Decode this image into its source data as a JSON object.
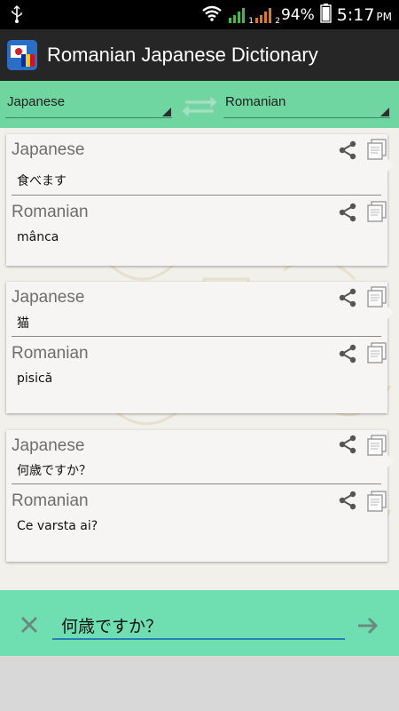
{
  "status_bar": {
    "battery_percent": "94%",
    "time": "5:17",
    "ampm": "PM",
    "signal_sim1": "1",
    "signal_sim2": "2"
  },
  "app": {
    "title": "Romanian Japanese Dictionary"
  },
  "language_selector": {
    "source": "Japanese",
    "target": "Romanian"
  },
  "cards": [
    {
      "source_label": "Japanese",
      "source_text": "食べます",
      "target_label": "Romanian",
      "target_text": "mânca"
    },
    {
      "source_label": "Japanese",
      "source_text": "猫",
      "target_label": "Romanian",
      "target_text": "pisică"
    },
    {
      "source_label": "Japanese",
      "source_text": "何歳ですか？",
      "target_label": "Romanian",
      "target_text": "Ce varsta ai?"
    }
  ],
  "input": {
    "value": "何歳ですか？"
  },
  "colors": {
    "accent_green": "#6fd6a2",
    "input_bar_green": "#6fdfb2",
    "app_bar": "#262626",
    "input_underline": "#2a7fb8"
  },
  "icons": {
    "usb": "usb-icon",
    "wifi": "wifi-icon",
    "signal": "signal-icon",
    "battery": "battery-icon",
    "app_logo": "app-logo-icon",
    "swap": "swap-languages-icon",
    "share": "share-icon",
    "copy": "copy-icon",
    "clear": "close-icon",
    "submit": "arrow-right-icon"
  }
}
